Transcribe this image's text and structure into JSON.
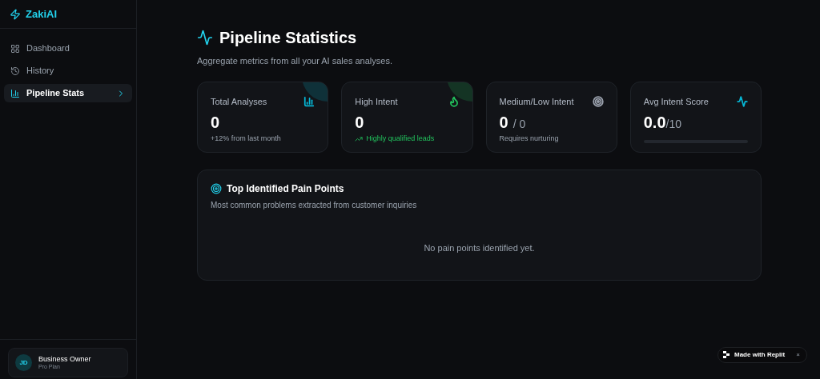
{
  "brand": {
    "name": "ZakiAI"
  },
  "sidebar": {
    "items": [
      {
        "label": "Dashboard",
        "selected": false
      },
      {
        "label": "History",
        "selected": false
      },
      {
        "label": "Pipeline Stats",
        "selected": true
      }
    ]
  },
  "user": {
    "initials": "JD",
    "name": "Business Owner",
    "plan": "Pro Plan"
  },
  "header": {
    "title": "Pipeline Statistics",
    "subtitle": "Aggregate metrics from all your AI sales analyses."
  },
  "cards": [
    {
      "kind": "count",
      "label": "Total Analyses",
      "value": "0",
      "note": "+12% from last month",
      "color": "#06b6d4",
      "highlighted": true
    },
    {
      "kind": "trend",
      "label": "High Intent",
      "value": "0",
      "note": "Highly qualified leads",
      "color": "#22c55e",
      "highlighted": true
    },
    {
      "kind": "ratio",
      "label": "Medium/Low Intent",
      "value": "0",
      "suffix": "/ 0",
      "note": "Requires nurturing",
      "color": "#9ca3af",
      "highlighted": false
    },
    {
      "kind": "score",
      "label": "Avg Intent Score",
      "value": "0.0",
      "suffix": "/10",
      "color": "#06b6d4",
      "highlighted": false
    }
  ],
  "pain_points": {
    "title": "Top Identified Pain Points",
    "subtitle": "Most common problems extracted from customer inquiries",
    "empty": "No pain points identified yet."
  },
  "badge": {
    "label": "Made with Replit",
    "close": "×"
  }
}
